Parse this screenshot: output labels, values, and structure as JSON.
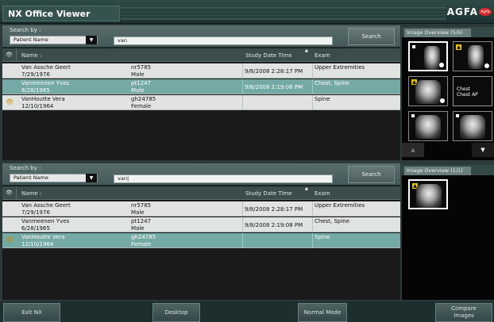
{
  "app": {
    "title": "NX Office Viewer",
    "brand": "AGFA",
    "brand_logo_text": "Agfa"
  },
  "search_top": {
    "label": "Search by :",
    "field": "Patient Name",
    "value": "van",
    "button": "Search"
  },
  "search_bottom": {
    "label": "Search by :",
    "field": "Patient Name",
    "value": "van|",
    "button": "Search"
  },
  "columns": {
    "name": "Name :",
    "study_date": "Study Date Time",
    "exam": "Exam"
  },
  "patients_top": [
    {
      "name": "Van Assche Geert",
      "dob": "7/29/1976",
      "id": "nr5785",
      "sex": "Male",
      "date": "9/8/2008 2:28:17 PM",
      "exam": "Upper Extremities"
    },
    {
      "name": "Vanmeenen Yves",
      "dob": "6/28/1965",
      "id": "pt1247",
      "sex": "Male",
      "date": "9/8/2008 2:19:08 PM",
      "exam": "Chest, Spine"
    },
    {
      "name": "VanHoutte Vera",
      "dob": "12/10/1964",
      "id": "gh24785",
      "sex": "Female",
      "date": "",
      "exam": "Spine"
    }
  ],
  "patients_bottom": [
    {
      "name": "Van Assche Geert",
      "dob": "7/29/1976",
      "id": "nr5785",
      "sex": "Male",
      "date": "9/8/2008 2:28:17 PM",
      "exam": "Upper Extremities"
    },
    {
      "name": "Vanmeenen Yves",
      "dob": "6/28/1965",
      "id": "pt1247",
      "sex": "Male",
      "date": "9/8/2008 2:19:08 PM",
      "exam": "Chest, Spine"
    },
    {
      "name": "VanHoutte Vera",
      "dob": "12/10/1964",
      "id": "gh24785",
      "sex": "Female",
      "date": "",
      "exam": "Spine"
    }
  ],
  "overview_top": {
    "tab": "Image Overview (5/6)",
    "thumb_text": "Chest\nChest AP"
  },
  "overview_bottom": {
    "tab": "Image Overview (1/1)"
  },
  "footer": {
    "exit": "Exit NX",
    "desktop": "Desktop",
    "normal": "Normal Mode",
    "compare": "Compare\nImages"
  },
  "icons": {
    "eye": "eye-icon",
    "dropdown": "chevron-down-icon"
  },
  "colors": {
    "selected_row": "#74a9a6",
    "brand_red": "#d8282b"
  }
}
